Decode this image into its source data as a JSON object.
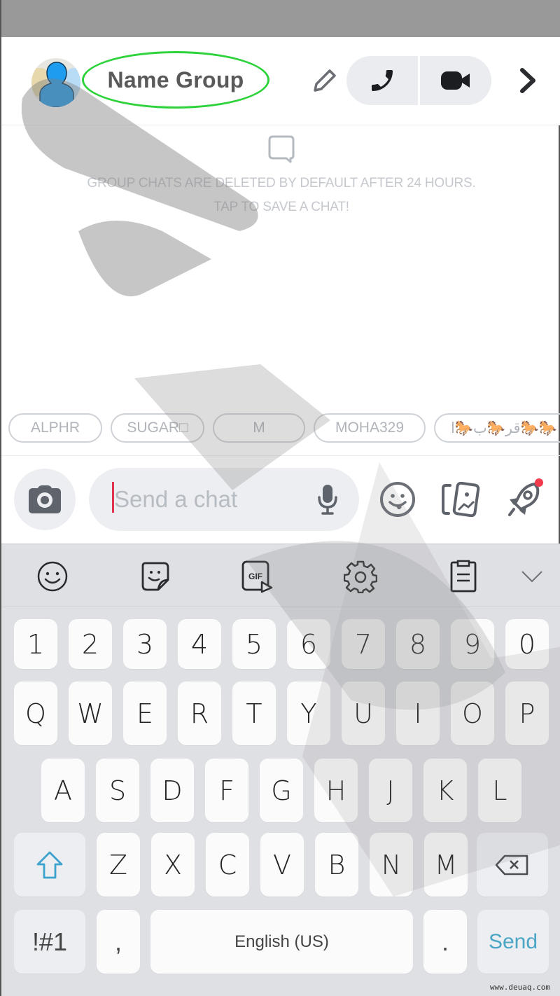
{
  "header": {
    "group_name": "Name Group",
    "avatar_label": "group-avatar",
    "actions": {
      "edit": "pencil-icon",
      "voice_call": "phone-icon",
      "video_call": "video-camera-icon",
      "more": "chevron-right-icon"
    }
  },
  "info": {
    "icon": "chat-bubble-icon",
    "line1": "GROUP CHATS ARE DELETED BY DEFAULT AFTER 24 HOURS.",
    "line2": "TAP TO SAVE A CHAT!"
  },
  "members": [
    {
      "label": "ALPHR"
    },
    {
      "label": "SUGAR□"
    },
    {
      "label": "M"
    },
    {
      "label": "MOHA329"
    },
    {
      "label": "قر🐎ب🐎ا🐎🐎"
    }
  ],
  "composer": {
    "placeholder": "Send a chat",
    "value": "",
    "camera": "camera-icon",
    "mic": "microphone-icon",
    "emoji": "smiley-icon",
    "memories": "memories-cards-icon",
    "games": "rocket-icon",
    "games_has_notification": true
  },
  "keyboard": {
    "toolbar": [
      "emoji-icon",
      "sticker-icon",
      "gif-icon",
      "settings-gear-icon",
      "clipboard-icon",
      "collapse-chevron-icon"
    ],
    "rows": {
      "numbers": [
        "1",
        "2",
        "3",
        "4",
        "5",
        "6",
        "7",
        "8",
        "9",
        "0"
      ],
      "row1": [
        "Q",
        "W",
        "E",
        "R",
        "T",
        "Y",
        "U",
        "I",
        "O",
        "P"
      ],
      "row2": [
        "A",
        "S",
        "D",
        "F",
        "G",
        "H",
        "J",
        "K",
        "L"
      ],
      "row3": [
        "Z",
        "X",
        "C",
        "V",
        "B",
        "N",
        "M"
      ]
    },
    "symbols_label": "!#1",
    "comma": ",",
    "space_label": "English (US)",
    "period": ".",
    "send_label": "Send"
  },
  "colors": {
    "highlight_ring": "#2ed33c",
    "caret": "#e0334d",
    "send": "#4ba5c4",
    "notification_dot": "#f23c4e"
  },
  "site_watermark": "www.deuaq.com"
}
